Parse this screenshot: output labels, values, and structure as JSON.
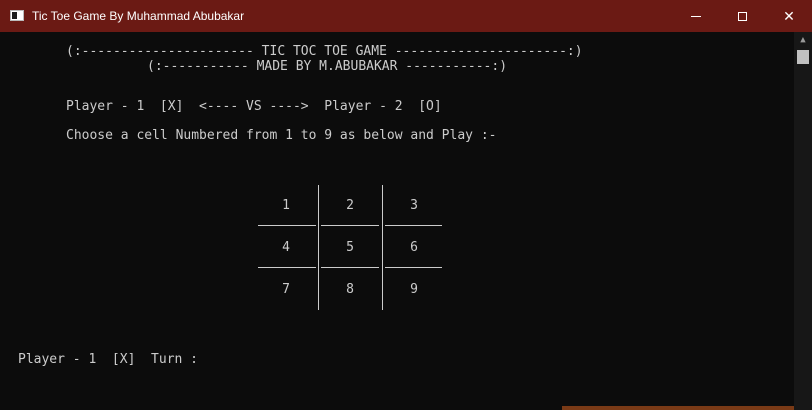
{
  "window": {
    "title": "Tic Toe Game By Muhammad Abubakar",
    "buttons": [
      "minimize",
      "maximize",
      "close"
    ],
    "close_glyph": "✕"
  },
  "console": {
    "header1": "(:---------------------- TIC TOC TOE GAME ----------------------:)",
    "header2": "(:----------- MADE BY M.ABUBAKAR -----------:)",
    "players": "Player - 1  [X]  <---- VS ---->  Player - 2  [O]",
    "instruction": "Choose a cell Numbered from 1 to 9 as below and Play :-",
    "cells": [
      "1",
      "2",
      "3",
      "4",
      "5",
      "6",
      "7",
      "8",
      "9"
    ],
    "turn": "Player - 1  [X]  Turn :"
  },
  "scrollbar": {
    "up_glyph": "▲"
  },
  "colors": {
    "titlebar": "#6b1a14",
    "console_bg": "#0c0c0c",
    "console_text": "#cccccc"
  }
}
